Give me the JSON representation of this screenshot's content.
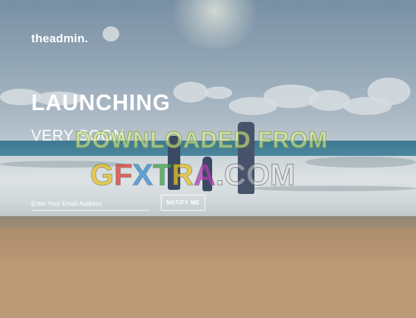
{
  "brand": {
    "name": "theadmin."
  },
  "hero": {
    "title": "LAUNCHING",
    "subtitle": "VERY SOON"
  },
  "signup": {
    "email_placeholder": "Enter Your Email Address",
    "notify_label": "NOTIFY ME"
  },
  "watermark": {
    "line1": "DOWNLOADED FROM",
    "line2_letters": [
      "G",
      "F",
      "X",
      "T",
      "R",
      "A"
    ],
    "line2_suffix": ".COM",
    "line2_colors": [
      "#e8c21f",
      "#e2392f",
      "#2f8fd9",
      "#3aa84a",
      "#e8c21f",
      "#b23bb5"
    ]
  },
  "colors": {
    "text": "#ffffff",
    "sky": "#9fb2c2",
    "sea": "#4f8ea6",
    "sand": "#c7a27a"
  }
}
